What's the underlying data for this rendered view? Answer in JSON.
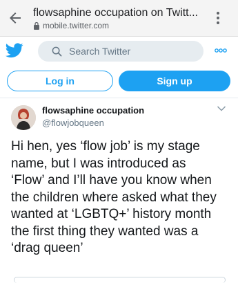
{
  "browser": {
    "page_title": "flowsaphine occupation on Twitt...",
    "url": "mobile.twitter.com",
    "back_icon": "arrow-left-icon",
    "menu_icon": "kebab-menu-icon"
  },
  "twitter_bar": {
    "logo_icon": "twitter-bird-icon",
    "search_placeholder": "Search Twitter",
    "more_icon": "more-dots-icon"
  },
  "auth": {
    "login_label": "Log in",
    "signup_label": "Sign up"
  },
  "tweet": {
    "display_name": "flowsaphine occupation",
    "handle": "@flowjobqueen",
    "text": "Hi hen, yes ‘flow job’ is my stage\nname, but I was introduced as\n‘Flow’ and I’ll have you know when\nthe children where asked what they\nwanted at ‘LGBTQ+’ history month\nthe first thing they wanted was a\n‘drag queen’"
  },
  "colors": {
    "twitter_blue": "#1da1f2",
    "search_bg": "#e6ecf0",
    "secondary_text": "#657786"
  }
}
